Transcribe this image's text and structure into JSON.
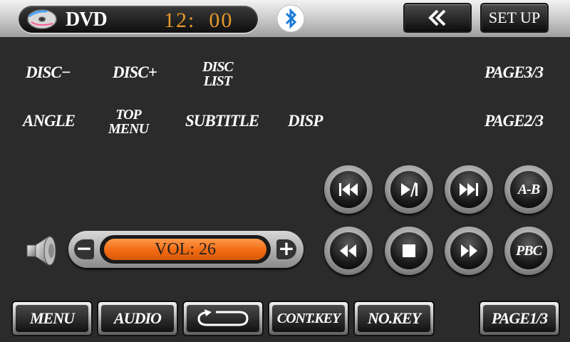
{
  "header": {
    "title": "DVD",
    "clock": "12:  00",
    "back_icon": "double-chevron-left-icon",
    "setup_label": "SET UP"
  },
  "commands": {
    "row1": {
      "disc_minus": "DISC−",
      "disc_plus": "DISC+",
      "disc_list_l1": "DISC",
      "disc_list_l2": "LIST",
      "page": "PAGE3/3"
    },
    "row2": {
      "angle": "ANGLE",
      "top_menu_l1": "TOP",
      "top_menu_l2": "MENU",
      "subtitle": "SUBTITLE",
      "disp": "DISP",
      "page": "PAGE2/3"
    }
  },
  "media": {
    "ab_label": "A-B",
    "pbc_label": "PBC"
  },
  "volume": {
    "display": "VOL: 26",
    "level": 26,
    "minus": "−",
    "plus": "+"
  },
  "bottom": {
    "menu": "MENU",
    "audio": "AUDIO",
    "return_icon": "return-icon",
    "cont_key": "CONT.KEY",
    "no_key": "NO.KEY",
    "page": "PAGE1/3"
  },
  "colors": {
    "clock": "#e59a2c",
    "volume_display": "#f26a12",
    "bluetooth": "#1a7bd6"
  }
}
